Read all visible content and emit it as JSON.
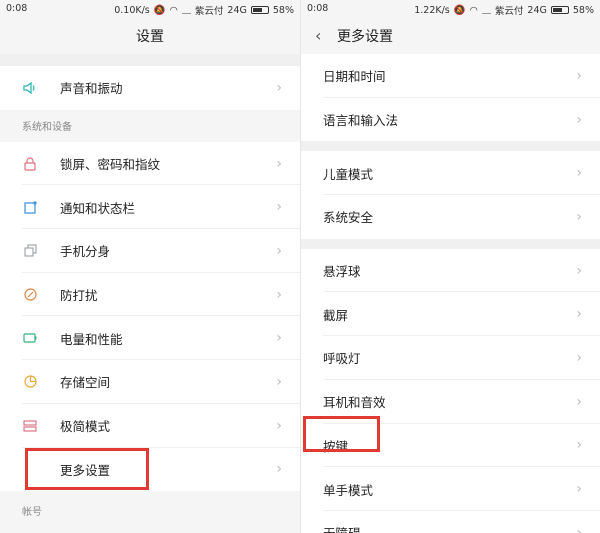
{
  "left": {
    "status": {
      "time": "0:08",
      "speed": "0.10K/s",
      "carrier": "紫云付",
      "net": "24G",
      "battery": "58%"
    },
    "title": "设置",
    "top_item": {
      "label": "声音和振动",
      "icon": "speaker-icon"
    },
    "section": "系统和设备",
    "items": [
      {
        "label": "锁屏、密码和指纹",
        "icon": "lock-icon",
        "color": "#e0707a"
      },
      {
        "label": "通知和状态栏",
        "icon": "notification-icon",
        "color": "#3a8fd8"
      },
      {
        "label": "手机分身",
        "icon": "clone-icon",
        "color": "#9aa0a6"
      },
      {
        "label": "防打扰",
        "icon": "do-not-disturb-icon",
        "color": "#e08a4a"
      },
      {
        "label": "电量和性能",
        "icon": "battery-icon",
        "color": "#34b07a"
      },
      {
        "label": "存储空间",
        "icon": "storage-icon",
        "color": "#e8a83a"
      },
      {
        "label": "极简模式",
        "icon": "simple-mode-icon",
        "color": "#d46a7a"
      },
      {
        "label": "更多设置",
        "icon": "more-icon",
        "color": "#666666"
      }
    ],
    "footer_section": "帐号"
  },
  "right": {
    "status": {
      "time": "0:08",
      "speed": "1.22K/s",
      "carrier": "紫云付",
      "net": "24G",
      "battery": "58%"
    },
    "title": "更多设置",
    "groups": [
      [
        "日期和时间",
        "语言和输入法"
      ],
      [
        "儿童模式",
        "系统安全"
      ],
      [
        "悬浮球",
        "截屏",
        "呼吸灯",
        "耳机和音效",
        "按键",
        "单手模式",
        "无障碍"
      ]
    ]
  },
  "colors": {
    "highlight": "#e03a33",
    "speaker": "#2eb8b0"
  }
}
